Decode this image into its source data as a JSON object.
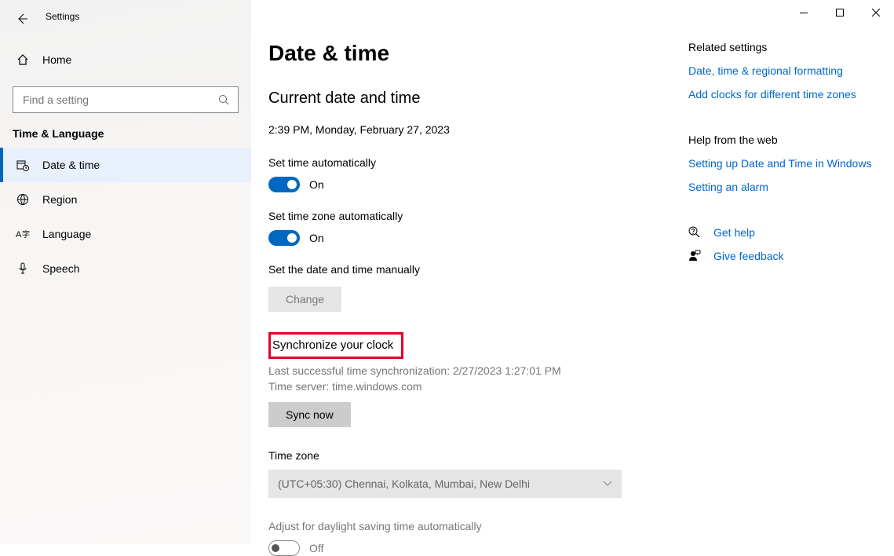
{
  "window": {
    "title": "Settings"
  },
  "sidebar": {
    "home": "Home",
    "search_placeholder": "Find a setting",
    "section": "Time & Language",
    "items": [
      {
        "label": "Date & time"
      },
      {
        "label": "Region"
      },
      {
        "label": "Language"
      },
      {
        "label": "Speech"
      }
    ]
  },
  "main": {
    "title": "Date & time",
    "current_heading": "Current date and time",
    "current_value": "2:39 PM, Monday, February 27, 2023",
    "set_time_auto_label": "Set time automatically",
    "set_time_auto_state": "On",
    "set_tz_auto_label": "Set time zone automatically",
    "set_tz_auto_state": "On",
    "manual_label": "Set the date and time manually",
    "change_btn": "Change",
    "sync_heading": "Synchronize your clock",
    "sync_last": "Last successful time synchronization: 2/27/2023 1:27:01 PM",
    "sync_server": "Time server: time.windows.com",
    "sync_btn": "Sync now",
    "tz_label": "Time zone",
    "tz_value": "(UTC+05:30) Chennai, Kolkata, Mumbai, New Delhi",
    "dst_label": "Adjust for daylight saving time automatically",
    "dst_state": "Off"
  },
  "right": {
    "related_heading": "Related settings",
    "related_links": [
      "Date, time & regional formatting",
      "Add clocks for different time zones"
    ],
    "help_heading": "Help from the web",
    "help_links": [
      "Setting up Date and Time in Windows",
      "Setting an alarm"
    ],
    "get_help": "Get help",
    "feedback": "Give feedback"
  }
}
